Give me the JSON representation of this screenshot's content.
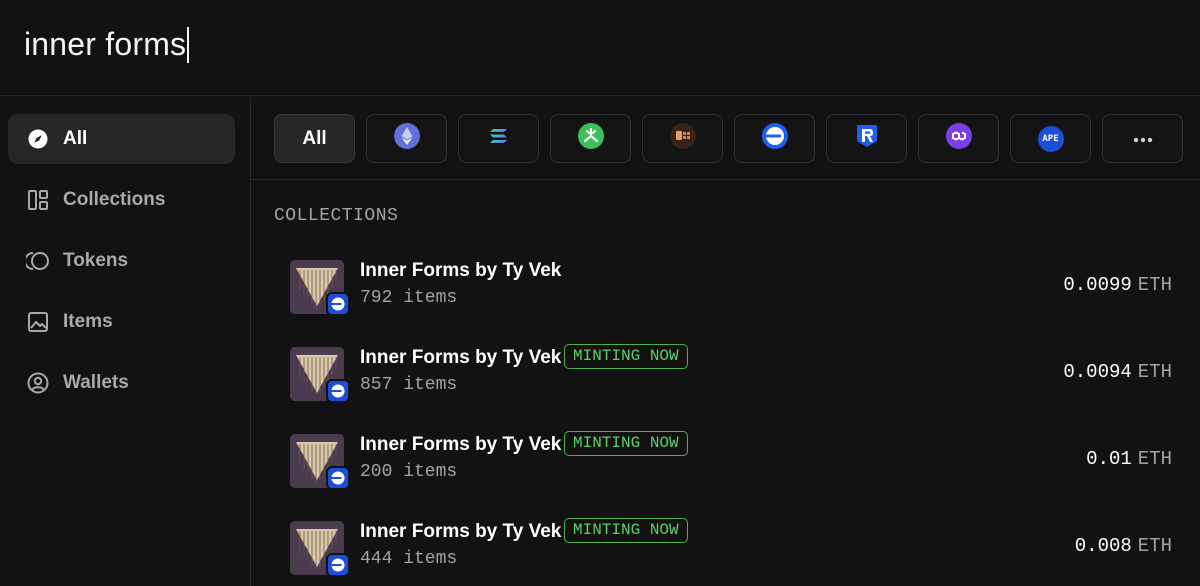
{
  "search": {
    "query": "inner forms"
  },
  "sidebar": {
    "items": [
      {
        "label": "All",
        "icon": "compass-icon",
        "active": true
      },
      {
        "label": "Collections",
        "icon": "grid-layout-icon",
        "active": false
      },
      {
        "label": "Tokens",
        "icon": "coins-icon",
        "active": false
      },
      {
        "label": "Items",
        "icon": "image-icon",
        "active": false
      },
      {
        "label": "Wallets",
        "icon": "user-circle-icon",
        "active": false
      }
    ]
  },
  "chains": {
    "all_label": "All",
    "items": [
      "ethereum-icon",
      "solana-icon",
      "chain-green-icon",
      "chain-brown-icon",
      "base-icon",
      "chain-shield-icon",
      "polygon-icon",
      "ape-icon",
      "more-icon"
    ],
    "ape_text": "APE"
  },
  "collections": {
    "title": "COLLECTIONS",
    "rows": [
      {
        "name": "Inner Forms by Ty Vek",
        "items": "792 items",
        "minting": "",
        "price": "0.0099",
        "unit": "ETH"
      },
      {
        "name": "Inner Forms by Ty Vek",
        "items": "857 items",
        "minting": "MINTING NOW",
        "price": "0.0094",
        "unit": "ETH"
      },
      {
        "name": "Inner Forms by Ty Vek",
        "items": "200 items",
        "minting": "MINTING NOW",
        "price": "0.01",
        "unit": "ETH"
      },
      {
        "name": "Inner Forms by Ty Vek",
        "items": "444 items",
        "minting": "MINTING NOW",
        "price": "0.008",
        "unit": "ETH"
      }
    ]
  },
  "colors": {
    "accent_green": "#4caf50",
    "base_blue": "#1d4ed8",
    "background": "#121212"
  }
}
